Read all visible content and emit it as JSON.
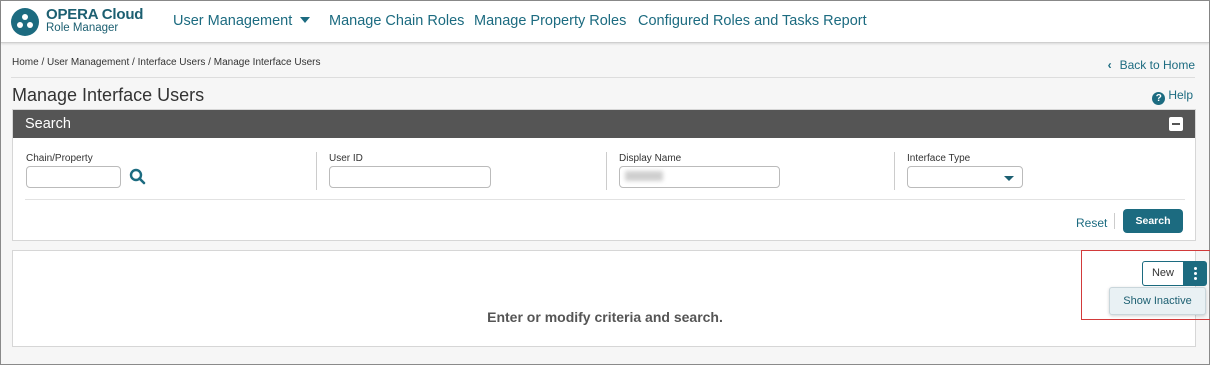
{
  "brand": {
    "title": "OPERA Cloud",
    "subtitle": "Role Manager"
  },
  "nav": {
    "user_management": "User Management",
    "manage_chain_roles": "Manage Chain Roles",
    "manage_property_roles": "Manage Property Roles",
    "configured_roles_report": "Configured Roles and Tasks Report"
  },
  "breadcrumb": "Home / User Management / Interface Users / Manage Interface Users",
  "back_to_home": "Back to Home",
  "page_title": "Manage Interface Users",
  "help": "Help",
  "search": {
    "title": "Search",
    "fields": {
      "chain_property": {
        "label": "Chain/Property",
        "value": ""
      },
      "user_id": {
        "label": "User ID",
        "value": ""
      },
      "display_name": {
        "label": "Display Name",
        "value": ""
      },
      "interface_type": {
        "label": "Interface Type",
        "value": ""
      }
    },
    "reset_label": "Reset",
    "search_label": "Search"
  },
  "results": {
    "empty_message": "Enter or modify criteria and search.",
    "new_label": "New",
    "menu_items": [
      "Show Inactive"
    ]
  },
  "colors": {
    "accent": "#1c6b80",
    "header": "#555555",
    "highlight": "#d23a3a"
  }
}
